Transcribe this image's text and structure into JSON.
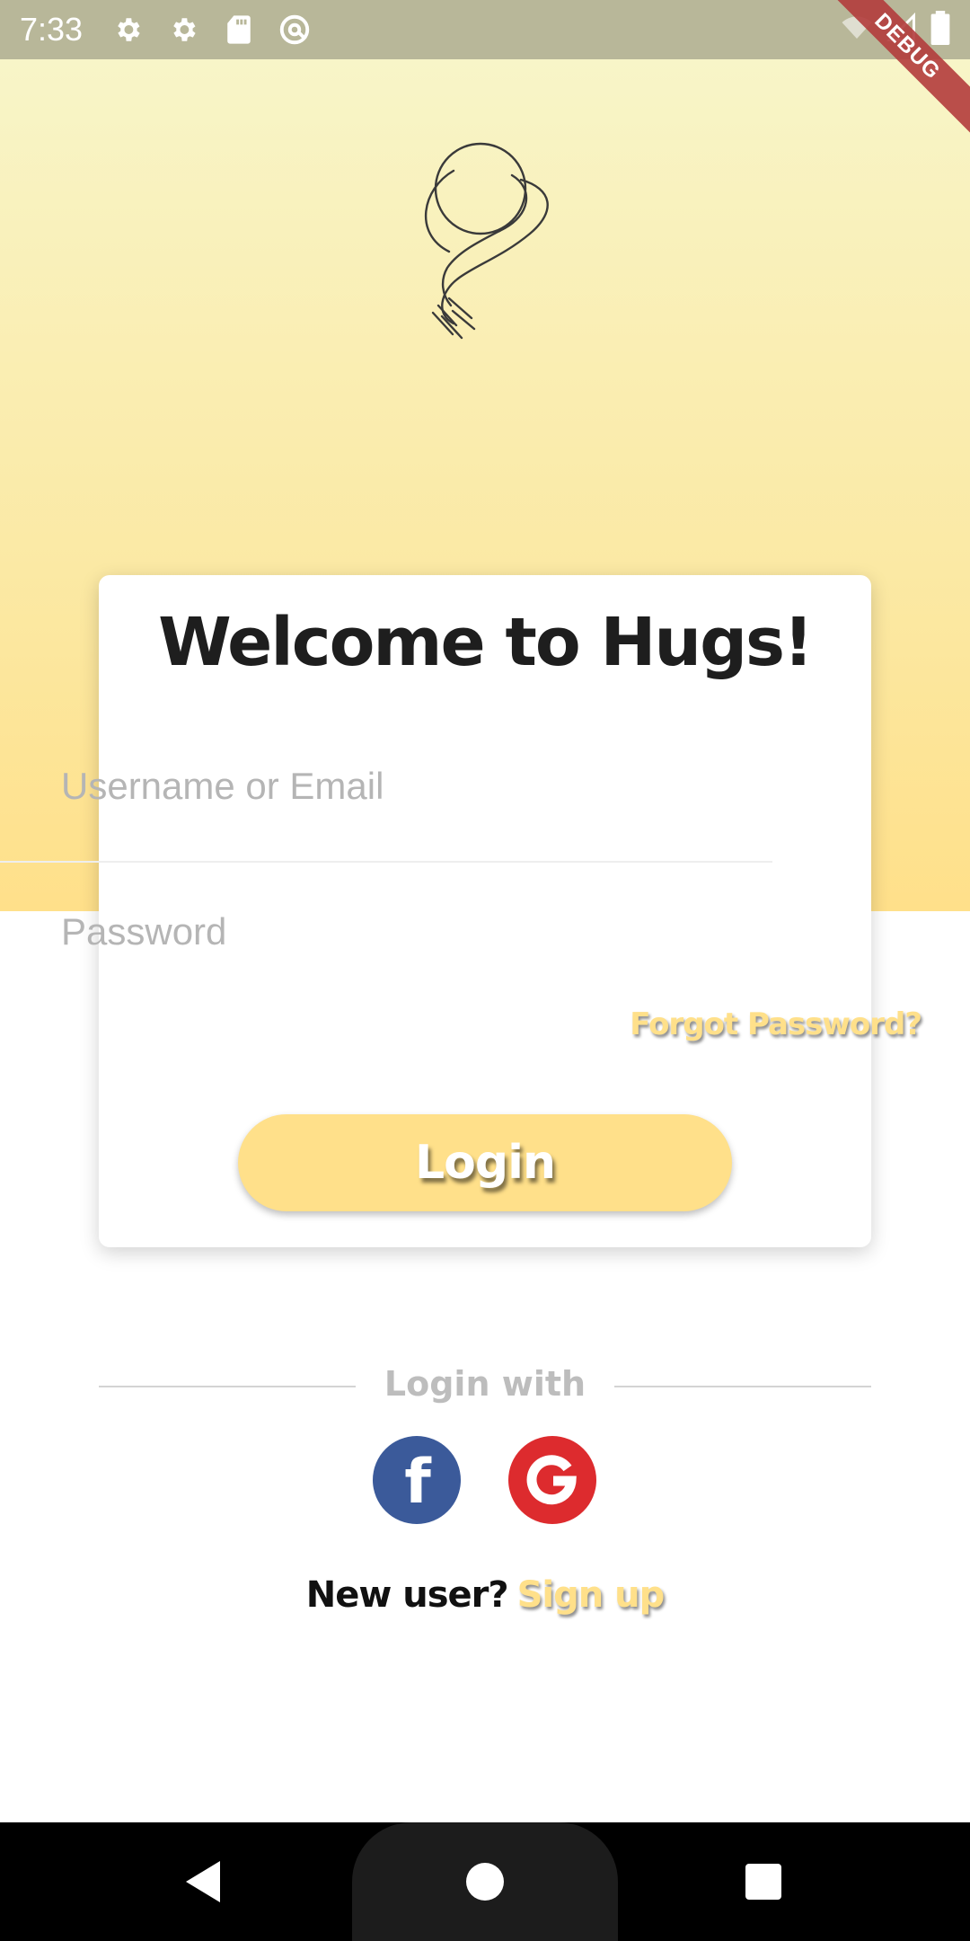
{
  "status_bar": {
    "time": "7:33",
    "icons": [
      "gear-icon",
      "gear-icon",
      "sd-card-icon",
      "at-sync-icon"
    ],
    "right_icons": [
      "wifi-off-icon",
      "signal-icon",
      "battery-icon"
    ],
    "debug_label": "DEBUG"
  },
  "theme": {
    "accent": "#ffe08a",
    "gradient_top": "#f8f5c8",
    "gradient_bottom": "#ffe08a",
    "facebook": "#3b5a9a",
    "google": "#dd2b2e"
  },
  "logo": {
    "icon": "scarf-icon"
  },
  "card": {
    "title": "Welcome to Hugs!",
    "username_placeholder": "Username or Email",
    "password_placeholder": "Password",
    "forgot_label": "Forgot Password?",
    "login_label": "Login"
  },
  "social": {
    "label": "Login with",
    "facebook_glyph": "f",
    "google_glyph": "G"
  },
  "signup": {
    "question": "New user?",
    "link": "Sign up"
  },
  "nav": {
    "icons": [
      "back-icon",
      "home-icon",
      "recents-icon"
    ]
  }
}
